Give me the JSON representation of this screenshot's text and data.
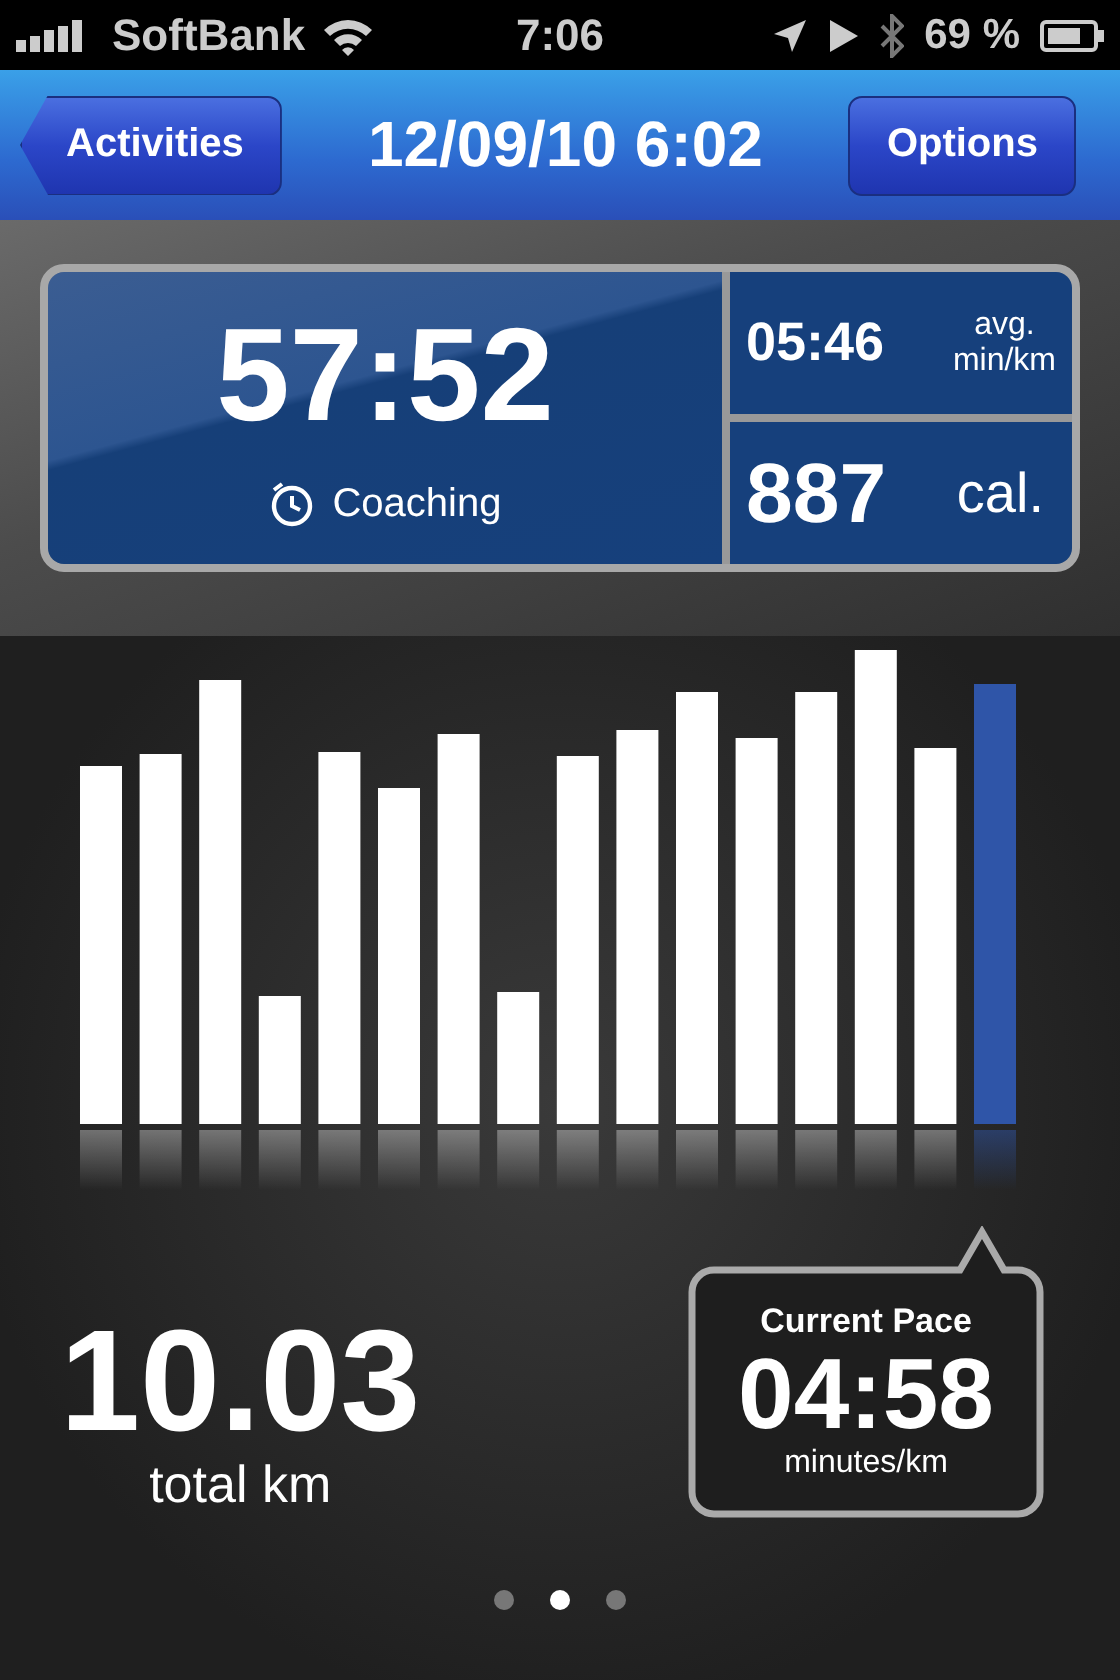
{
  "status_bar": {
    "carrier": "SoftBank",
    "time": "7:06",
    "battery": "69 %"
  },
  "nav": {
    "back": "Activities",
    "title": "12/09/10 6:02",
    "action": "Options"
  },
  "summary": {
    "duration": "57:52",
    "coaching": "Coaching",
    "avg_pace": "05:46",
    "avg_label": "avg.",
    "avg_unit": "min/km",
    "calories": "887",
    "calories_unit": "cal."
  },
  "distance": {
    "value": "10.03",
    "unit": "total km"
  },
  "current_pace": {
    "title": "Current Pace",
    "value": "04:58",
    "unit": "minutes/km"
  },
  "page_dots": [
    {
      "selected": false
    },
    {
      "selected": true
    },
    {
      "selected": false
    }
  ]
}
